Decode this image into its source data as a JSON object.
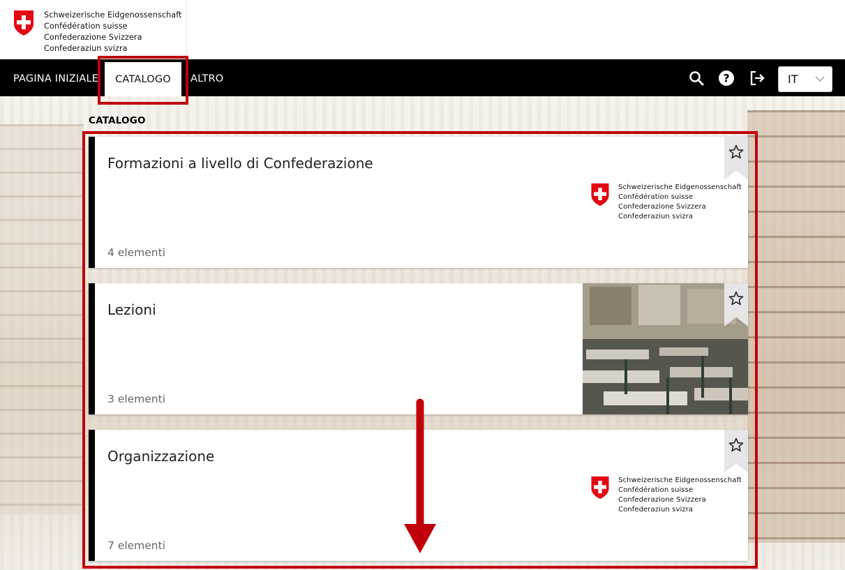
{
  "header": {
    "logo_lines": [
      "Schweizerische Eidgenossenschaft",
      "Confédération suisse",
      "Confederazione Svizzera",
      "Confederaziun svizra"
    ]
  },
  "nav": {
    "items": [
      {
        "label": "PAGINA INIZIALE"
      },
      {
        "label": "CATALOGO",
        "active": true
      },
      {
        "label": "ALTRO"
      }
    ],
    "icons": [
      "search-icon",
      "help-icon",
      "logout-icon"
    ],
    "language": {
      "selected": "IT"
    }
  },
  "page": {
    "title": "CATALOGO"
  },
  "cards": [
    {
      "title": "Formazioni a livello di Confederazione",
      "count": "4 elementi",
      "media": "swiss-logo",
      "logo_lines": [
        "Schweizerische Eidgenossenschaft",
        "Confédération suisse",
        "Confederazione Svizzera",
        "Confederaziun svizra"
      ]
    },
    {
      "title": "Lezioni",
      "count": "3 elementi",
      "media": "classroom-photo"
    },
    {
      "title": "Organizzazione",
      "count": "7 elementi",
      "media": "swiss-logo",
      "logo_lines": [
        "Schweizerische Eidgenossenschaft",
        "Confédération suisse",
        "Confederazione Svizzera",
        "Confederaziun svizra"
      ]
    }
  ],
  "colors": {
    "nav_bg": "#000000",
    "annotation_red": "#c0000b",
    "swiss_red": "#e30613"
  }
}
